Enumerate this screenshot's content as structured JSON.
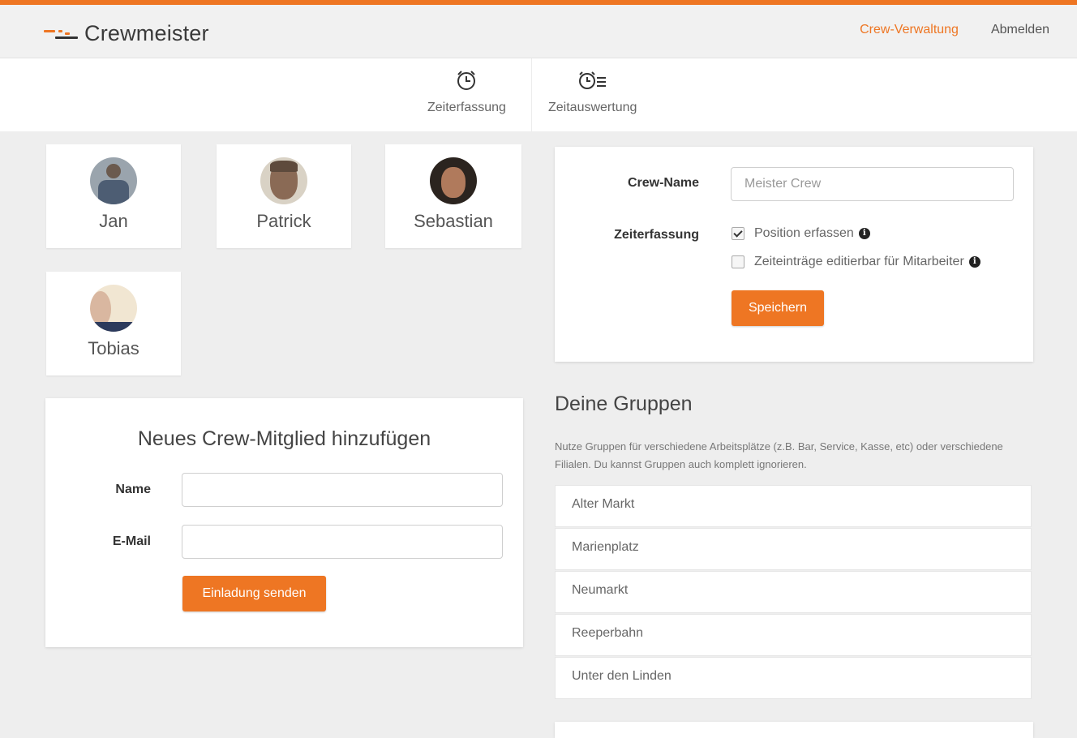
{
  "header": {
    "brand": "Crewmeister",
    "brand_color": "#ee7623",
    "nav": [
      {
        "label": "Crew-Verwaltung",
        "active": true
      },
      {
        "label": "Abmelden",
        "active": false
      }
    ]
  },
  "subnav": [
    {
      "label": "Zeiterfassung",
      "icon": "alarm-clock-icon"
    },
    {
      "label": "Zeitauswertung",
      "icon": "clock-list-icon"
    }
  ],
  "members": [
    {
      "name": "Jan"
    },
    {
      "name": "Patrick"
    },
    {
      "name": "Sebastian"
    },
    {
      "name": "Tobias"
    }
  ],
  "invite": {
    "title": "Neues Crew-Mitglied hinzufügen",
    "name_label": "Name",
    "name_value": "",
    "email_label": "E-Mail",
    "email_value": "",
    "button": "Einladung senden"
  },
  "settings": {
    "crew_name_label": "Crew-Name",
    "crew_name_value": "Meister Crew",
    "time_label": "Zeiterfassung",
    "options": [
      {
        "label": "Position erfassen",
        "checked": true
      },
      {
        "label": "Zeiteinträge editierbar für Mitarbeiter",
        "checked": false
      }
    ],
    "save_button": "Speichern"
  },
  "groups": {
    "title": "Deine Gruppen",
    "description": "Nutze Gruppen für verschiedene Arbeitsplätze (z.B. Bar, Service, Kasse, etc) oder verschiedene Filialen. Du kannst Gruppen auch komplett ignorieren.",
    "items": [
      "Alter Markt",
      "Marienplatz",
      "Neumarkt",
      "Reeperbahn",
      "Unter den Linden"
    ]
  }
}
